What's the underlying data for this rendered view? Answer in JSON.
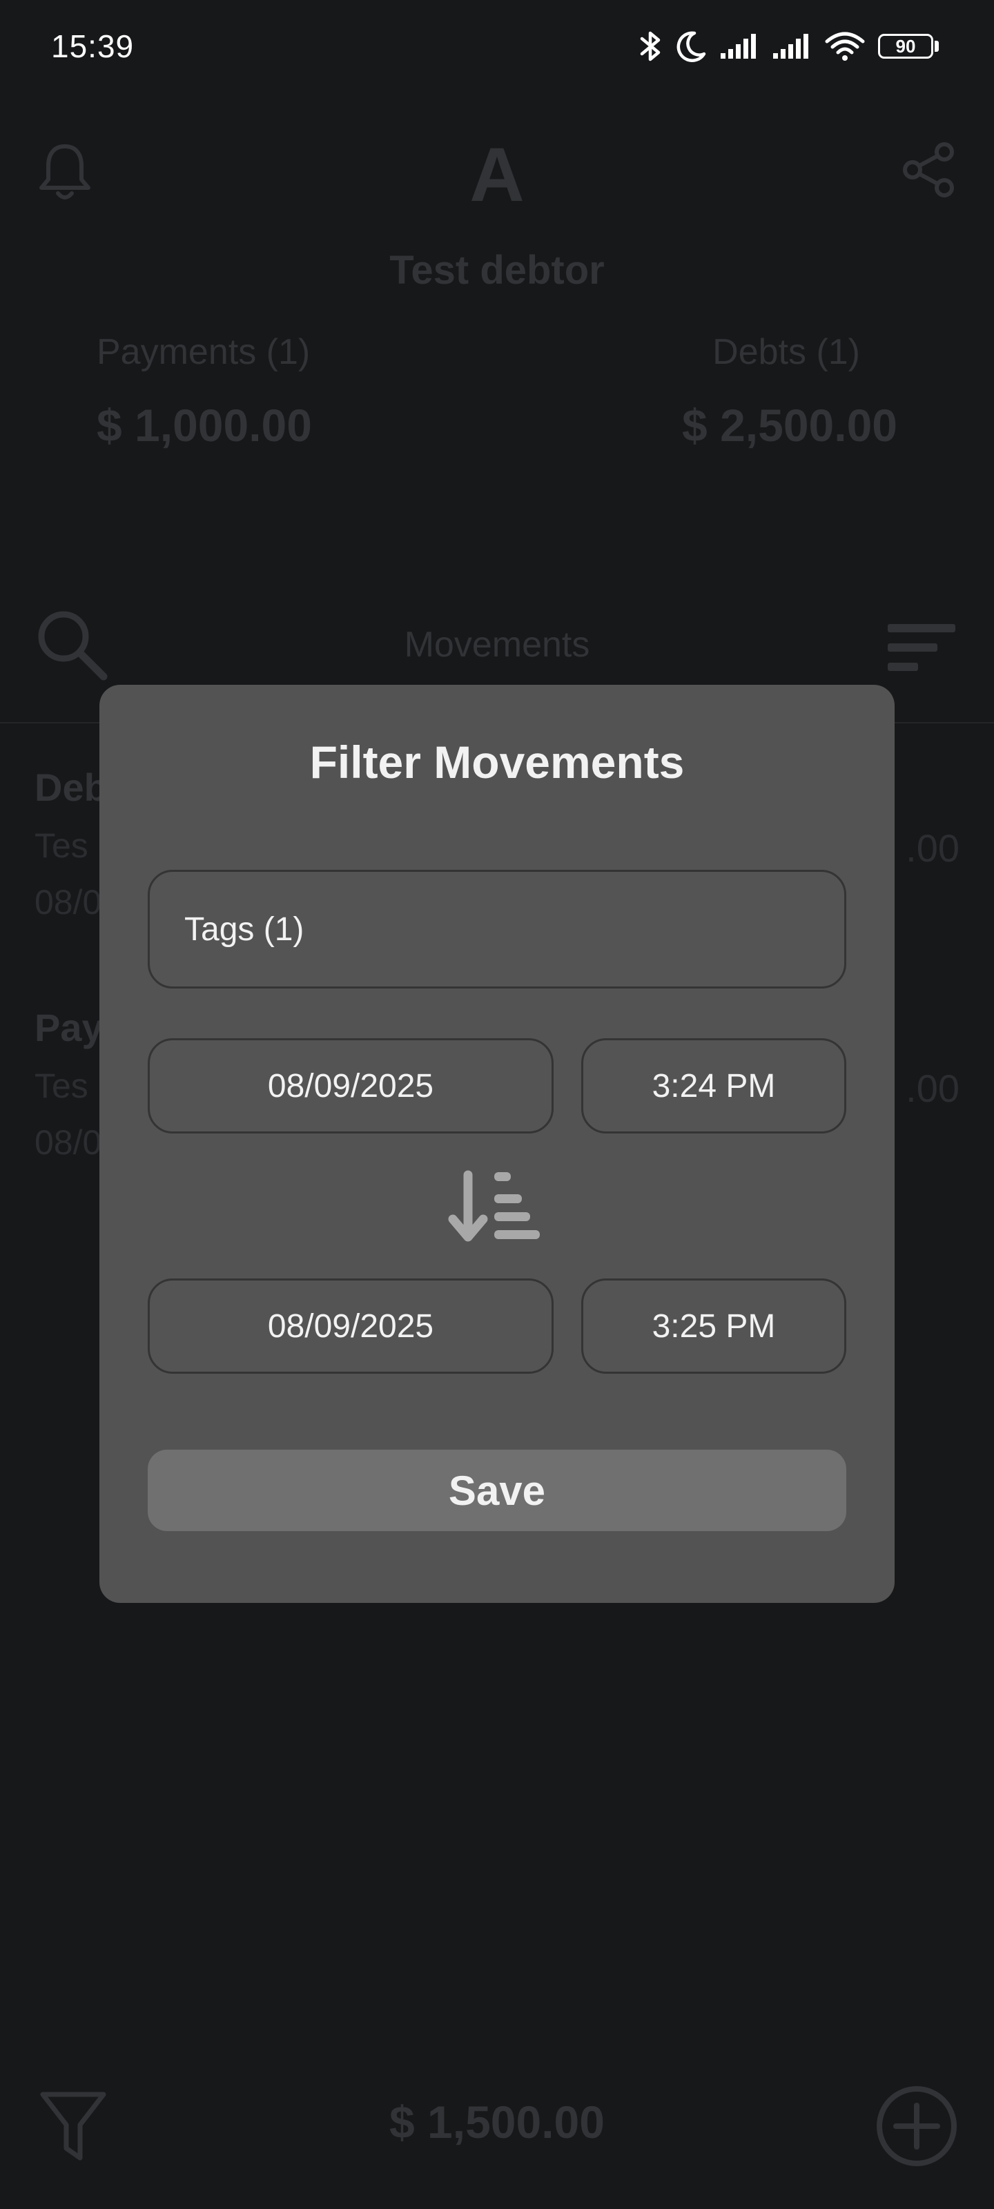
{
  "status_bar": {
    "time": "15:39",
    "battery": "90",
    "icons": [
      "bluetooth-icon",
      "moon-icon",
      "signal-icon",
      "signal-icon",
      "wifi-icon",
      "battery-icon"
    ]
  },
  "header": {
    "avatar_letter": "A",
    "debtor_name": "Test debtor",
    "left_icon": "bell-icon",
    "right_icon": "share-icon"
  },
  "summary": {
    "payments_label": "Payments (1)",
    "payments_value": "$ 1,000.00",
    "debts_label": "Debts (1)",
    "debts_value": "$ 2,500.00"
  },
  "movements_bar": {
    "title": "Movements",
    "left_icon": "search-icon",
    "right_icon": "sort-icon"
  },
  "movement_rows": [
    {
      "title": "Deb",
      "line1": "Tes",
      "line2": "08/0",
      "amount": ".00"
    },
    {
      "title": "Pay",
      "line1": "Tes",
      "line2": "08/0",
      "amount": ".00"
    }
  ],
  "bottom_bar": {
    "left_icon": "filter-icon",
    "balance": "$ 1,500.00",
    "right_icon": "add-icon"
  },
  "dialog": {
    "title": "Filter Movements",
    "tags_field": "Tags  (1)",
    "from_date": "08/09/2025",
    "from_time": "3:24 PM",
    "order_icon": "sort-descending-icon",
    "to_date": "08/09/2025",
    "to_time": "3:25 PM",
    "save_label": "Save"
  },
  "colors": {
    "background": "#17181a",
    "dialog": "#535353",
    "save_button": "#707070",
    "dimmed_text": "#313336"
  }
}
